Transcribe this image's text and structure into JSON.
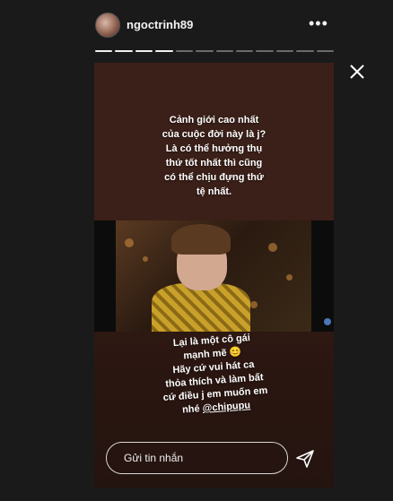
{
  "header": {
    "username": "ngoctrinh89",
    "more_label": "•••",
    "progress": {
      "segments": 12,
      "current": 5
    }
  },
  "story": {
    "text_top": "Cảnh giới cao nhất\ncủa cuộc đời này là j?\nLà có thể hưởng thụ\nthứ tốt nhất thì cũng\ncó thể chịu đựng thứ\ntệ nhất.",
    "text_bottom_main": "Lại là một cô gái\nmạnh mẽ 😊\nHãy cứ vui hát ca\nthỏa thích và làm bất\ncứ điều j em muốn em\nnhé ",
    "text_bottom_mention": "@chipupu"
  },
  "reply": {
    "placeholder": "Gửi tin nhắn"
  },
  "icons": {
    "close": "close-icon",
    "send": "send-icon",
    "more": "more-options-icon"
  }
}
